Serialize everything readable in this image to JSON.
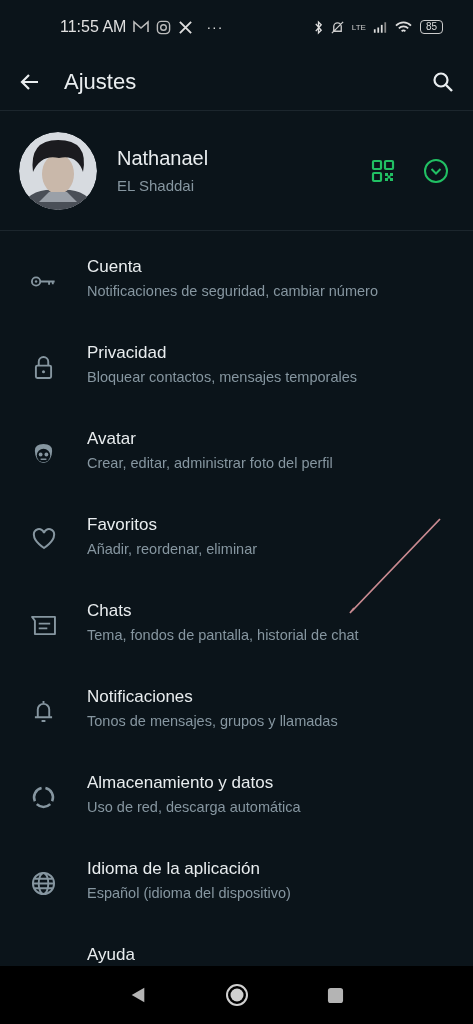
{
  "status_bar": {
    "time": "11:55 AM",
    "more": "···",
    "network": "LTE",
    "battery": "85"
  },
  "header": {
    "title": "Ajustes"
  },
  "profile": {
    "name": "Nathanael",
    "about": "EL Shaddai"
  },
  "settings": [
    {
      "kind": "key",
      "title": "Cuenta",
      "subtitle": "Notificaciones de seguridad, cambiar número"
    },
    {
      "kind": "lock",
      "title": "Privacidad",
      "subtitle": "Bloquear contactos, mensajes temporales"
    },
    {
      "kind": "avatar",
      "title": "Avatar",
      "subtitle": "Crear, editar, administrar foto del perfil"
    },
    {
      "kind": "heart",
      "title": "Favoritos",
      "subtitle": "Añadir, reordenar, eliminar"
    },
    {
      "kind": "chat",
      "title": "Chats",
      "subtitle": "Tema, fondos de pantalla, historial de chat"
    },
    {
      "kind": "bell",
      "title": "Notificaciones",
      "subtitle": "Tonos de mensajes, grupos y llamadas"
    },
    {
      "kind": "storage",
      "title": "Almacenamiento y datos",
      "subtitle": "Uso de red, descarga automática"
    },
    {
      "kind": "globe",
      "title": "Idioma de la aplicación",
      "subtitle": "Español (idioma del dispositivo)"
    },
    {
      "kind": "help",
      "title": "Ayuda"
    }
  ]
}
